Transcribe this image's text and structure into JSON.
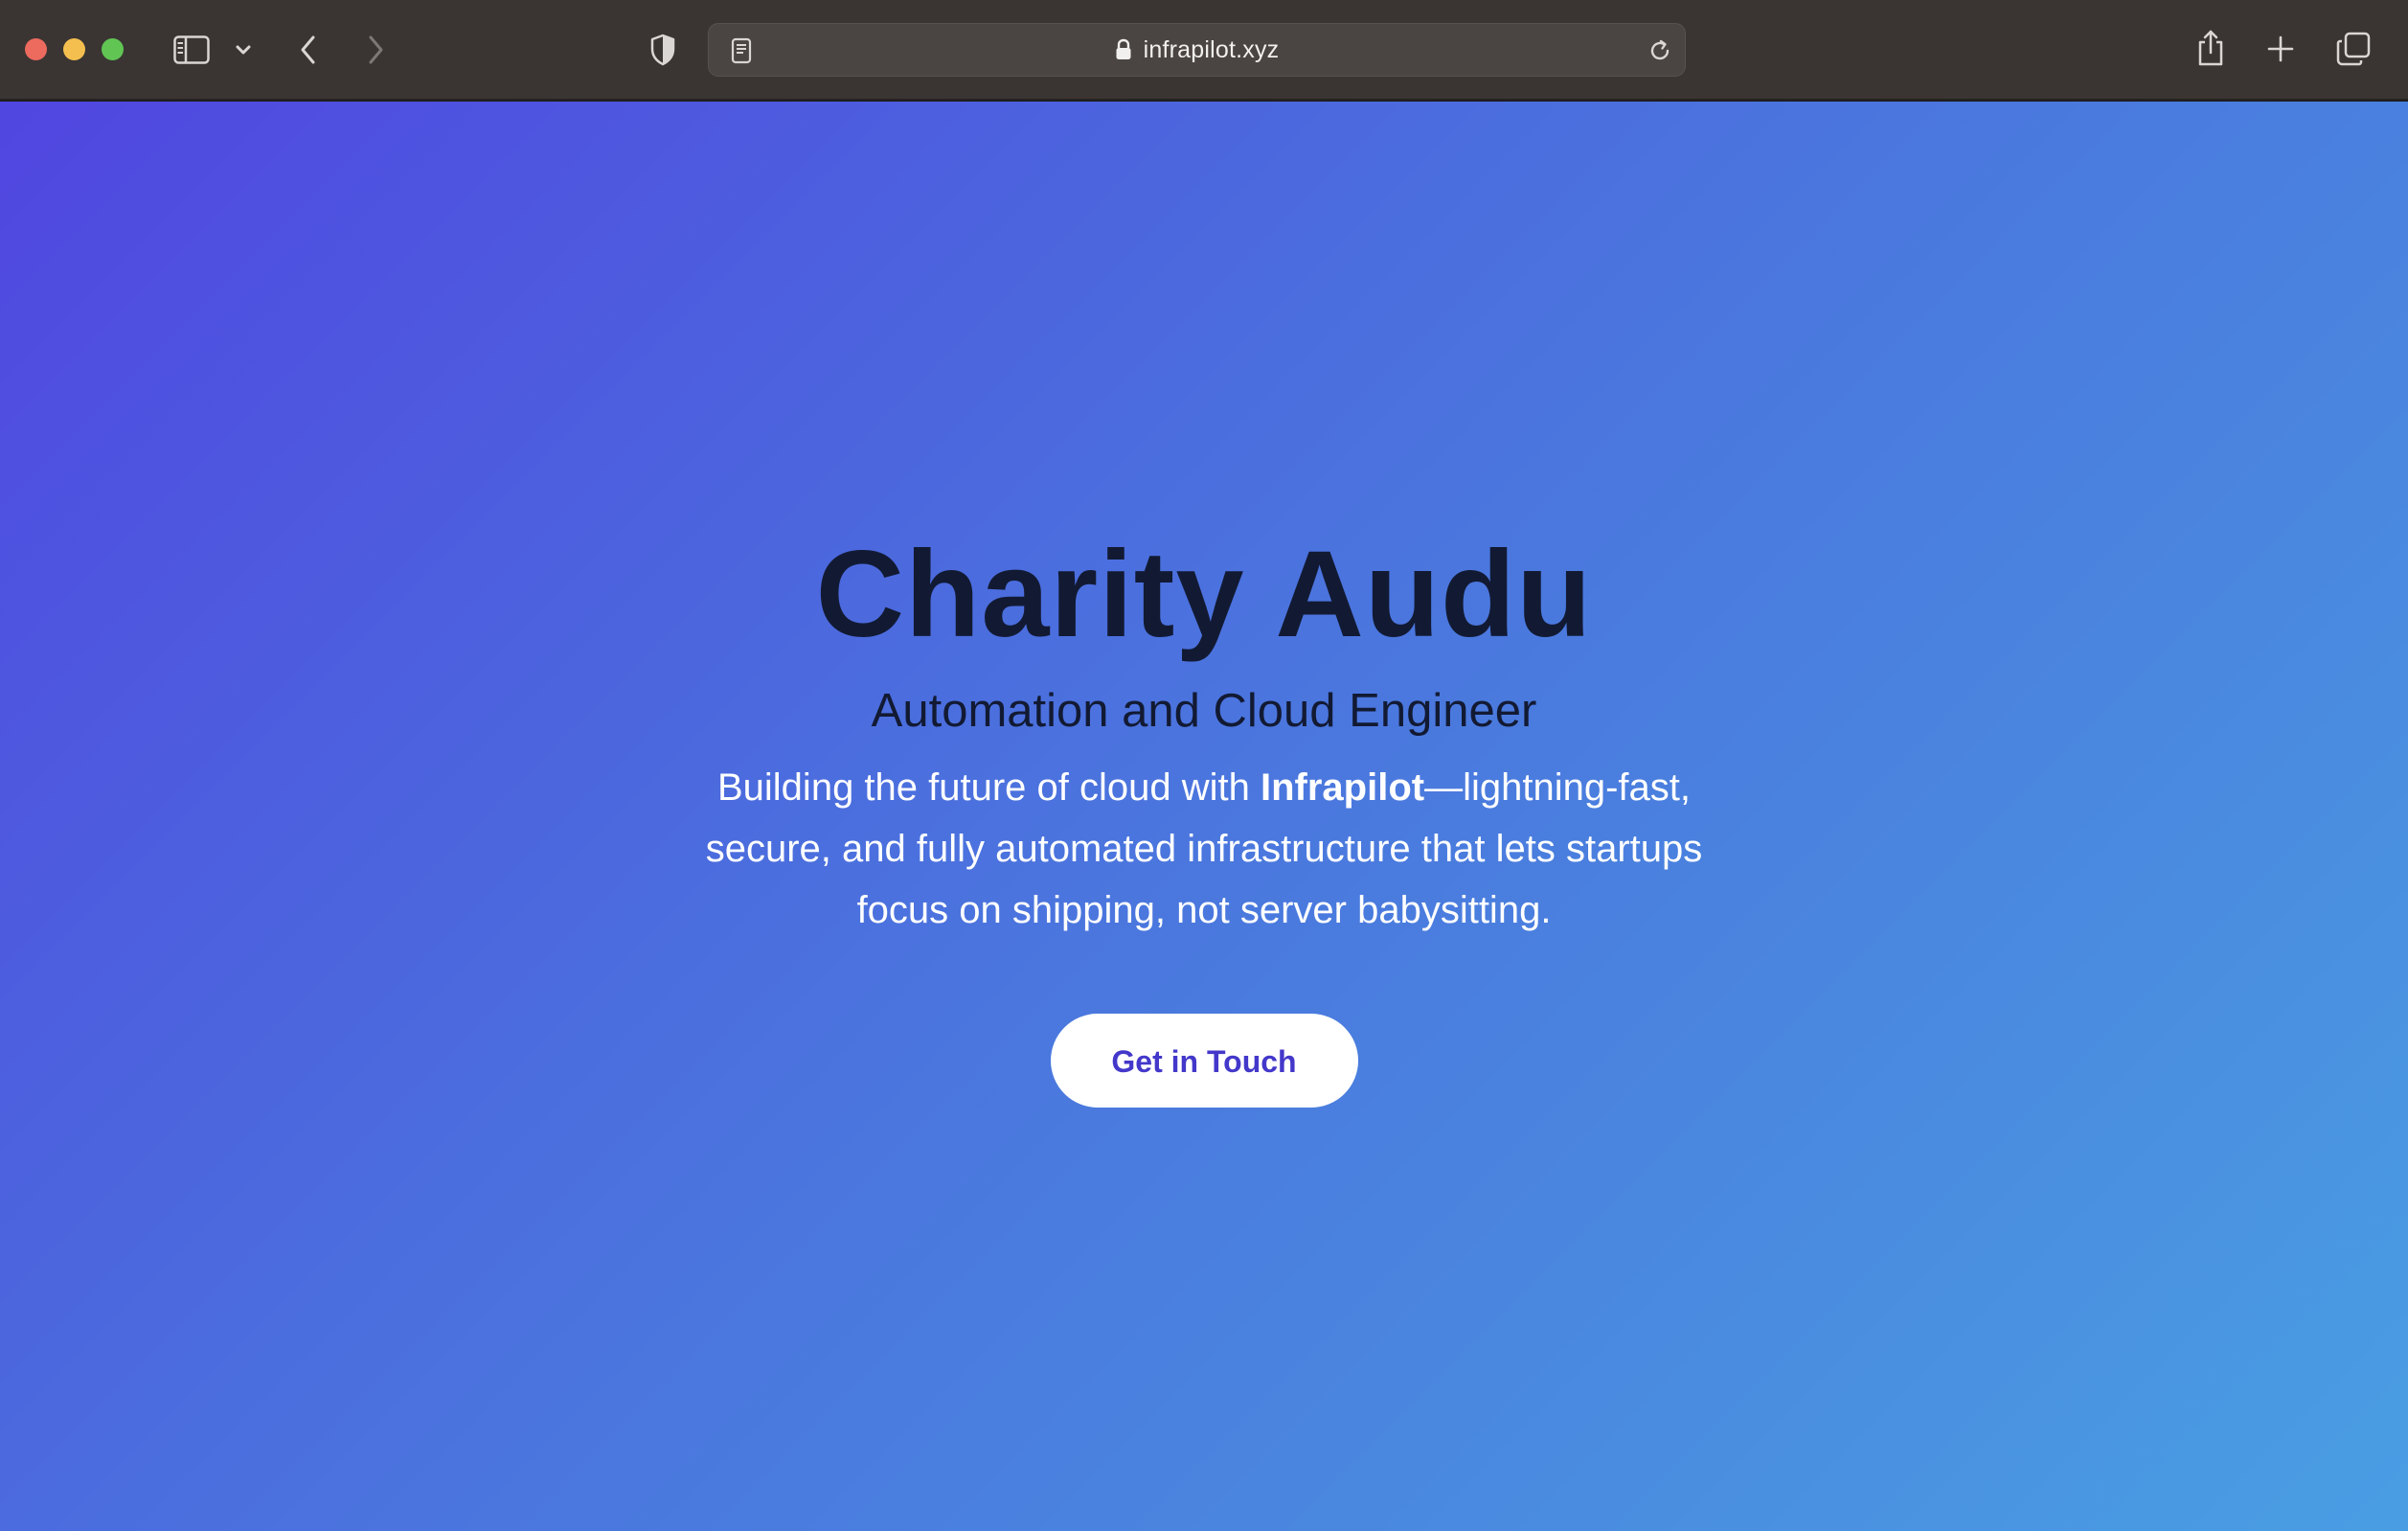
{
  "browser": {
    "url": "infrapilot.xyz",
    "icons": {
      "close": "close-window",
      "minimize": "minimize-window",
      "maximize": "maximize-window",
      "sidebar": "sidebar-icon",
      "sidebar_menu": "chevron-down-icon",
      "back": "chevron-left-icon",
      "forward": "chevron-right-icon",
      "privacy": "shield-icon",
      "reader": "reader-icon",
      "lock": "lock-icon",
      "reload": "reload-icon",
      "share": "share-icon",
      "new_tab": "plus-icon",
      "tabs_overview": "tabs-icon"
    }
  },
  "hero": {
    "name": "Charity Audu",
    "role": "Automation and Cloud Engineer",
    "description_before": "Building the future of cloud with ",
    "description_brand": "Infrapilot",
    "description_after": "—lightning-fast, secure, and fully automated infrastructure that lets startups focus on shipping, not server babysitting.",
    "cta_label": "Get in Touch"
  },
  "colors": {
    "toolbar_bg": "#3a3533",
    "gradient_start": "#5046e0",
    "gradient_end": "#499ee3",
    "heading_text": "#121a33",
    "cta_text": "#4338ca",
    "cta_bg": "#ffffff"
  }
}
